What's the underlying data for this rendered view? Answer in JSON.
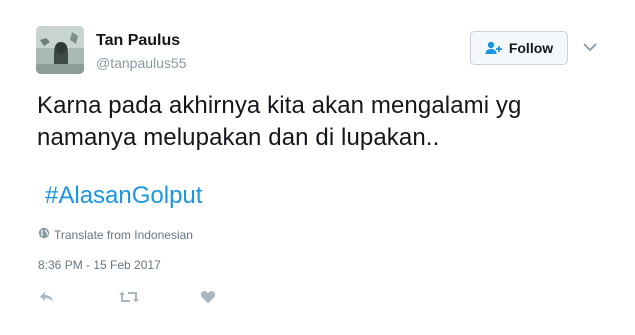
{
  "user": {
    "name": "Tan Paulus",
    "handle": "@tanpaulus55"
  },
  "follow": {
    "label": "Follow"
  },
  "tweet": {
    "text": "Karna pada akhirnya kita akan mengalami yg namanya melupakan dan di lupakan..",
    "hashtag": "#AlasanGolput"
  },
  "translate": {
    "label": "Translate from Indonesian"
  },
  "timestamp": "8:36 PM - 15 Feb 2017",
  "colors": {
    "link": "#1b95e0",
    "muted": "#8899a6",
    "icon": "#aab8c2"
  },
  "icons": [
    "avatar",
    "follow-person-plus-icon",
    "chevron-down-icon",
    "globe-icon",
    "reply-icon",
    "retweet-icon",
    "heart-icon"
  ]
}
